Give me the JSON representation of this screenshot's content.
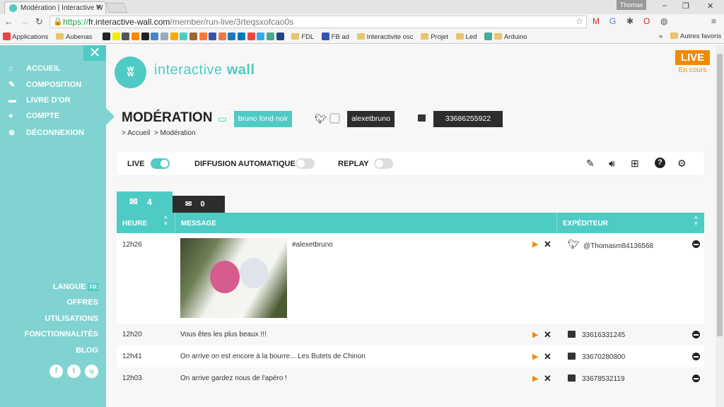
{
  "browser": {
    "tab_title": "Modération | Interactive W",
    "user": "Thomas",
    "url_scheme": "https://",
    "url_domain": "fr.interactive-wall.com",
    "url_path": "/member/run-live/3rteqsxofcao0s",
    "bookmarks": [
      "Applications",
      "Aubenas",
      "FDL",
      "FB ad",
      "Interactivite osc",
      "Projet",
      "Led",
      "Arduino"
    ],
    "other_bookmarks": "Autres favoris",
    "more": "»"
  },
  "sidebar": {
    "close": "✕",
    "items": [
      {
        "icon": "home-icon",
        "label": "ACCUEIL"
      },
      {
        "icon": "pencil-icon",
        "label": "COMPOSITION"
      },
      {
        "icon": "book-icon",
        "label": "LIVRE D'OR"
      },
      {
        "icon": "user-icon",
        "label": "COMPTE"
      },
      {
        "icon": "logout-icon",
        "label": "DÉCONNEXION"
      }
    ],
    "language_label": "LANGUE",
    "language_code": "FR",
    "bottom_links": [
      "OFFRES",
      "UTILISATIONS",
      "FONCTIONNALITÉS",
      "BLOG"
    ],
    "social": [
      "f",
      "t",
      "ig"
    ]
  },
  "header": {
    "brand_light": "interactive ",
    "brand_bold": "wall",
    "live_badge": "LIVE",
    "live_status": "En cours"
  },
  "page": {
    "title": "MODÉRATION",
    "breadcrumb": [
      "> Accueil",
      "> Modération"
    ],
    "screen_name": "bruno fond noir",
    "hashtag": "alexetbruno",
    "phone": "33686255922"
  },
  "toolbar": {
    "live": "LIVE",
    "auto": "DIFFUSION AUTOMATIQUE",
    "replay": "REPLAY",
    "live_on": true,
    "auto_on": false,
    "replay_on": false
  },
  "tabs": {
    "inbox_count": "4",
    "rejected_count": "0"
  },
  "table": {
    "headers": [
      "HEURE",
      "MESSAGE",
      "EXPÉDITEUR"
    ],
    "rows": [
      {
        "time": "12h26",
        "message": "#alexetbruno",
        "source": "twitter",
        "sender": "@Thomasm84136568",
        "has_image": true
      },
      {
        "time": "12h20",
        "message": "Vous êtes les plus beaux !!!",
        "source": "sms",
        "sender": "33616331245"
      },
      {
        "time": "12h41",
        "message": "On arrive on est encore à la bourre... Les Butets de Chinon",
        "source": "sms",
        "sender": "33670280800"
      },
      {
        "time": "12h03",
        "message": "On arrive gardez nous de l'apéro !",
        "source": "sms",
        "sender": "33678532119"
      }
    ]
  },
  "colors": {
    "teal": "#4ecbc4",
    "sidebar": "#80d3d0",
    "orange": "#f28a00",
    "dark": "#2d2d2d"
  }
}
